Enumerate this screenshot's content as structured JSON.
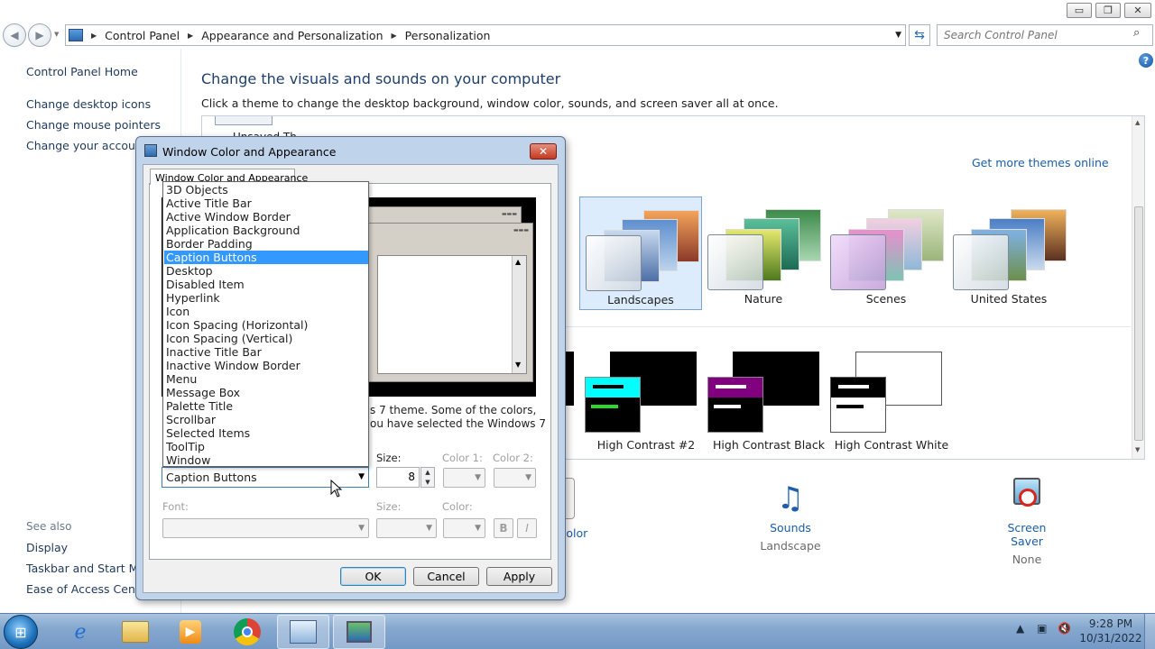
{
  "window": {
    "minimize": "▭",
    "maximize": "❐",
    "close": "✕"
  },
  "address": {
    "crumbs": [
      "Control Panel",
      "Appearance and Personalization",
      "Personalization"
    ],
    "search_placeholder": "Search Control Panel"
  },
  "leftnav": {
    "home": "Control Panel Home",
    "links": [
      "Change desktop icons",
      "Change mouse pointers",
      "Change your account p"
    ],
    "see_also": "See also",
    "see_also_links": [
      "Display",
      "Taskbar and Start Menu",
      "Ease of Access Center"
    ]
  },
  "main": {
    "heading": "Change the visuals and sounds on your computer",
    "subheading": "Click a theme to change the desktop background, window color, sounds, and screen saver all at once.",
    "partial_label": "Unsaved Th",
    "get_more": "Get more themes online",
    "themes": [
      {
        "label": "Landscapes",
        "selected": true
      },
      {
        "label": "Nature",
        "selected": false
      },
      {
        "label": "Scenes",
        "selected": false
      },
      {
        "label": "United States",
        "selected": false
      }
    ],
    "hc_themes": [
      "High Contrast #2",
      "High Contrast Black",
      "High Contrast White"
    ],
    "bottom": {
      "color_label": "Color",
      "sounds_label": "Sounds",
      "sounds_value": "Landscape",
      "saver_label": "Screen Saver",
      "saver_value": "None"
    }
  },
  "dialog": {
    "title": "Window Color and Appearance",
    "tab": "Window Color and Appearance",
    "desc1": "s 7 theme.  Some of the colors,",
    "desc2": "ou have selected the Windows 7",
    "labels": {
      "size": "Size:",
      "color1": "Color 1:",
      "color2": "Color 2:",
      "font": "Font:",
      "font_size": "Size:",
      "color": "Color:"
    },
    "item_selected": "Caption Buttons",
    "size_value": "8",
    "bold": "B",
    "italic": "I",
    "buttons": {
      "ok": "OK",
      "cancel": "Cancel",
      "apply": "Apply"
    },
    "items": [
      "3D Objects",
      "Active Title Bar",
      "Active Window Border",
      "Application Background",
      "Border Padding",
      "Caption Buttons",
      "Desktop",
      "Disabled Item",
      "Hyperlink",
      "Icon",
      "Icon Spacing (Horizontal)",
      "Icon Spacing (Vertical)",
      "Inactive Title Bar",
      "Inactive Window Border",
      "Menu",
      "Message Box",
      "Palette Title",
      "Scrollbar",
      "Selected Items",
      "ToolTip",
      "Window"
    ],
    "selected_index": 5
  },
  "taskbar": {
    "clock_time": "9:28 PM",
    "clock_date": "10/31/2022",
    "apps": [
      "internet-explorer-icon",
      "file-explorer-icon",
      "media-player-icon",
      "chrome-icon",
      "control-panel-icon",
      "display-settings-icon"
    ]
  }
}
